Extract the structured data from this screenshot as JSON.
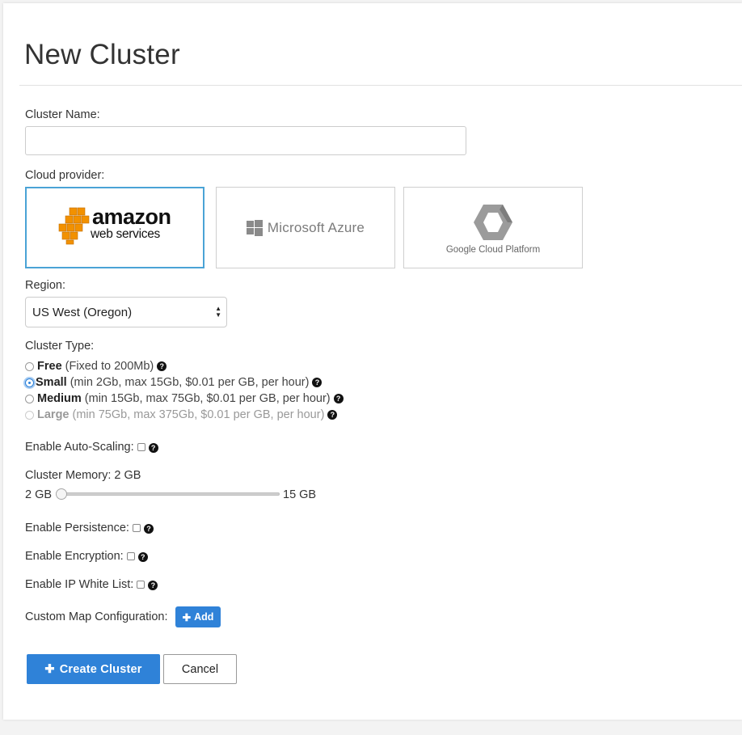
{
  "page": {
    "title": "New Cluster"
  },
  "form": {
    "cluster_name": {
      "label": "Cluster Name:",
      "value": "",
      "placeholder": ""
    },
    "cloud_provider": {
      "label": "Cloud provider:",
      "selected": "amazon",
      "options": [
        {
          "id": "amazon",
          "line1": "amazon",
          "line2": "web services",
          "icon": "aws-cubes-logo"
        },
        {
          "id": "azure",
          "text": "Microsoft Azure",
          "icon": "windows-logo"
        },
        {
          "id": "gcp",
          "text": "Google Cloud Platform",
          "icon": "gcp-hexagon-logo"
        }
      ]
    },
    "region": {
      "label": "Region:",
      "value": "US West (Oregon)"
    },
    "cluster_type": {
      "label": "Cluster Type:",
      "selected": "small",
      "options": [
        {
          "id": "free",
          "name": "Free",
          "detail": "(Fixed to 200Mb)",
          "disabled": false
        },
        {
          "id": "small",
          "name": "Small",
          "detail": "(min 2Gb, max 15Gb, $0.01 per GB, per hour)",
          "disabled": false
        },
        {
          "id": "medium",
          "name": "Medium",
          "detail": "(min 15Gb, max 75Gb, $0.01 per GB, per hour)",
          "disabled": false
        },
        {
          "id": "large",
          "name": "Large",
          "detail": "(min 75Gb, max 375Gb, $0.01 per GB, per hour)",
          "disabled": true
        }
      ]
    },
    "auto_scaling": {
      "label": "Enable Auto-Scaling:",
      "checked": false
    },
    "memory": {
      "label": "Cluster Memory:",
      "value": "2 GB",
      "min_label": "2 GB",
      "max_label": "15 GB",
      "level_fraction": 0.0
    },
    "persistence": {
      "label": "Enable Persistence:",
      "checked": false
    },
    "encryption": {
      "label": "Enable Encryption:",
      "checked": false
    },
    "ip_white_list": {
      "label": "Enable IP White List:",
      "checked": false
    },
    "custom_map": {
      "label": "Custom Map Configuration:",
      "add_label": "Add"
    }
  },
  "actions": {
    "create_label": "Create Cluster",
    "cancel_label": "Cancel"
  },
  "colors": {
    "primary": "#2f82d8",
    "selected_border": "#4aa3d6",
    "aws_orange": "#f29100"
  },
  "icons": {
    "help": "question-circle-icon",
    "plus": "plus-icon"
  }
}
